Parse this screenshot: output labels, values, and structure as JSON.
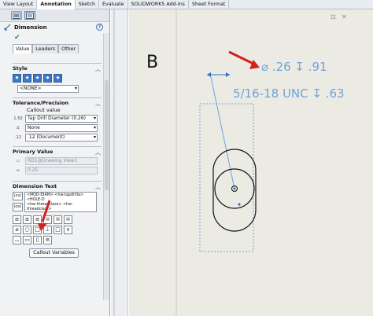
{
  "command_tabs": [
    "View Layout",
    "Annotation",
    "Sketch",
    "Evaluate",
    "SOLIDWORKS Add-Ins",
    "Sheet Format"
  ],
  "active_tab": "Annotation",
  "pm": {
    "title": "Dimension",
    "help": "?",
    "tabs": [
      "Value",
      "Leaders",
      "Other"
    ],
    "style": {
      "heading": "Style",
      "value": "<NONE>"
    },
    "tolerance": {
      "heading": "Tolerance/Precision",
      "callout_label": "Callout value",
      "callout_value": "Tap Drill Diameter (0.26)",
      "tolerance_type": "None",
      "precision": ".12 (Document)",
      "icon1": "1.50",
      "icon2": ".12"
    },
    "primary": {
      "heading": "Primary Value",
      "name": "RD1@Drawing View1",
      "value": "0.25"
    },
    "dimtext": {
      "heading": "Dimension Text",
      "text_line1": "<MOD-DIAM> <hw-tapdrilla> <HOLE-D",
      "text_line2": "<hw-threadclass> <hw-threadclass>",
      "button": "Callout Variables"
    },
    "symbols": [
      "⌀",
      "○",
      "□",
      "⊥",
      "□",
      "∨",
      "⌴",
      "▭",
      "▯",
      "≡"
    ]
  },
  "drawing": {
    "view_label": "B",
    "callout_line1": "⌀ .26 ↧ .91",
    "callout_line2": "5/16-18 UNC ↧ .63"
  },
  "colors": {
    "annotation": "#6fa3d8",
    "leader": "#2f6fc8",
    "arrow": "#d42020"
  }
}
